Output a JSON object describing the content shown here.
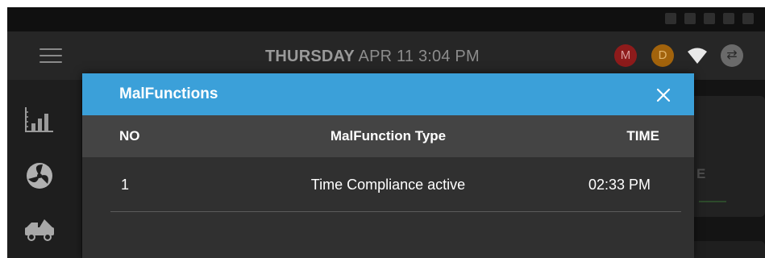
{
  "app_bar": {
    "day": "THURSDAY",
    "datetime": "APR 11 3:04 PM",
    "badges": [
      {
        "label": "M",
        "color": "#8e1b1b"
      },
      {
        "label": "D",
        "color": "#a2630c"
      }
    ],
    "icons": [
      "menu-icon",
      "wifi-icon",
      "sync-icon"
    ]
  },
  "sidebar": {
    "items": [
      {
        "icon": "bar-chart-icon"
      },
      {
        "icon": "fan-icon"
      },
      {
        "icon": "truck-icon"
      }
    ]
  },
  "background_card": {
    "letter": "E"
  },
  "dialog": {
    "title": "MalFunctions",
    "header_color": "#3ba0d9",
    "columns": {
      "no": "NO",
      "type": "MalFunction Type",
      "time": "TIME"
    },
    "rows": [
      {
        "no": "1",
        "type": "Time Compliance active",
        "time": "02:33 PM"
      }
    ]
  }
}
